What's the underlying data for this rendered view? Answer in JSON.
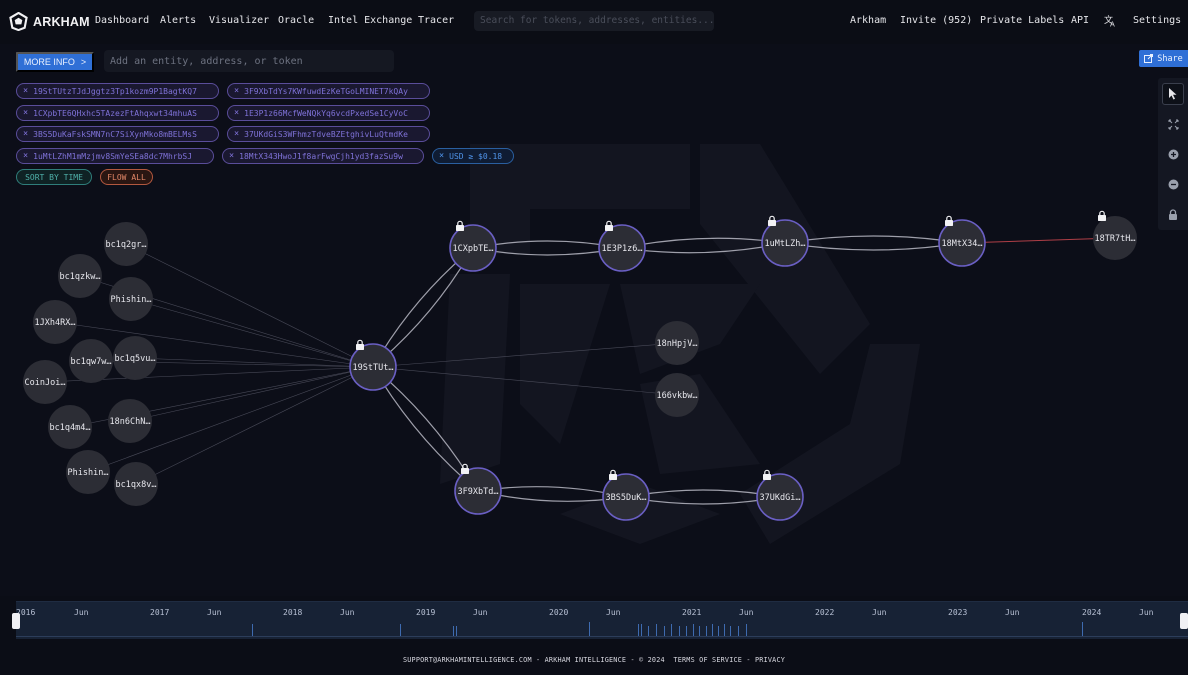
{
  "nav": {
    "brand": "ARKHAM",
    "items": [
      "Dashboard",
      "Alerts",
      "Visualizer",
      "Oracle",
      "Intel Exchange",
      "Tracer"
    ],
    "search_placeholder": "Search for tokens, addresses, entities...",
    "right_items": [
      "Arkham",
      "Invite (952)",
      "Private Labels",
      "API"
    ],
    "translate_icon": "translate-icon",
    "settings": "Settings"
  },
  "toolbar": {
    "more_info": "MORE INFO",
    "more_info_arrow": ">",
    "add_placeholder": "Add an entity, address, or token",
    "share": "Share"
  },
  "filters": {
    "addresses": [
      "19StTUtzTJdJggtz3Tp1kozm9P1BagtKQ7",
      "3F9XbTdYs7KWfuwdEzKeTGoLMINET7kQAy",
      "1CXpbTE6QHxhc5TAzezFtAhqxwt34mhuAS",
      "1E3P1z66McfWeNQkYq6vcdPxedSe1CyVoC",
      "3BS5DuKaFskSMN7nC7SiXynMko8mBELMsS",
      "37UKdGiS3WFhmzTdveBZEtghivLuQtmdKe",
      "1uMtLZhM1mMzjmv8SmYeSEa8dc7MhrbSJ",
      "18MtX343HwoJ1f8arFwgCjh1yd3fazSu9w"
    ],
    "usd_filter": "USD ≥ $0.18",
    "sort_by_time": "SORT BY TIME",
    "flow_all": "FLOW ALL",
    "remove_glyph": "×"
  },
  "graph": {
    "nodes": [
      {
        "id": "n1",
        "label": "bc1q2gr…",
        "tracked": false
      },
      {
        "id": "n2",
        "label": "bc1qzkw…",
        "tracked": false
      },
      {
        "id": "n3",
        "label": "Phishin…",
        "tracked": false
      },
      {
        "id": "n4",
        "label": "1JXh4RX…",
        "tracked": false
      },
      {
        "id": "n5",
        "label": "bc1qw7w…",
        "tracked": false
      },
      {
        "id": "n6",
        "label": "bc1q5vu…",
        "tracked": false
      },
      {
        "id": "n7",
        "label": "CoinJoi…",
        "tracked": false
      },
      {
        "id": "n8",
        "label": "bc1q4m4…",
        "tracked": false
      },
      {
        "id": "n9",
        "label": "18n6ChN…",
        "tracked": false
      },
      {
        "id": "n10",
        "label": "Phishin…",
        "tracked": false
      },
      {
        "id": "n11",
        "label": "bc1qx8v…",
        "tracked": false
      },
      {
        "id": "hub",
        "label": "19StTUt…",
        "tracked": true
      },
      {
        "id": "a1",
        "label": "1CXpbTE…",
        "tracked": true
      },
      {
        "id": "a2",
        "label": "1E3P1z6…",
        "tracked": true
      },
      {
        "id": "a3",
        "label": "1uMtLZh…",
        "tracked": true
      },
      {
        "id": "a4",
        "label": "18MtX34…",
        "tracked": true
      },
      {
        "id": "a5",
        "label": "18TR7tH…",
        "tracked": false,
        "locked": true
      },
      {
        "id": "b1",
        "label": "3F9XbTd…",
        "tracked": true
      },
      {
        "id": "b2",
        "label": "3BS5DuK…",
        "tracked": true
      },
      {
        "id": "b3",
        "label": "37UKdGi…",
        "tracked": true
      },
      {
        "id": "m1",
        "label": "18nHpjV…",
        "tracked": false
      },
      {
        "id": "m2",
        "label": "166vkbw…",
        "tracked": false
      }
    ],
    "edges": [
      {
        "from": "n1",
        "to": "hub",
        "type": "thin"
      },
      {
        "from": "n2",
        "to": "hub",
        "type": "thin"
      },
      {
        "from": "n3",
        "to": "hub",
        "type": "thin"
      },
      {
        "from": "n4",
        "to": "hub",
        "type": "thin"
      },
      {
        "from": "n5",
        "to": "hub",
        "type": "thin"
      },
      {
        "from": "n6",
        "to": "hub",
        "type": "thin"
      },
      {
        "from": "n7",
        "to": "hub",
        "type": "thin"
      },
      {
        "from": "n8",
        "to": "hub",
        "type": "thin"
      },
      {
        "from": "n9",
        "to": "hub",
        "type": "thin"
      },
      {
        "from": "n10",
        "to": "hub",
        "type": "thin"
      },
      {
        "from": "n11",
        "to": "hub",
        "type": "thin"
      },
      {
        "from": "hub",
        "to": "m1",
        "type": "thin"
      },
      {
        "from": "hub",
        "to": "m2",
        "type": "thin"
      },
      {
        "from": "hub",
        "to": "a1",
        "type": "double"
      },
      {
        "from": "hub",
        "to": "b1",
        "type": "double"
      },
      {
        "from": "a1",
        "to": "a2",
        "type": "double"
      },
      {
        "from": "a2",
        "to": "a3",
        "type": "double"
      },
      {
        "from": "a3",
        "to": "a4",
        "type": "double"
      },
      {
        "from": "a4",
        "to": "a5",
        "type": "red"
      },
      {
        "from": "b1",
        "to": "b2",
        "type": "double"
      },
      {
        "from": "b2",
        "to": "b3",
        "type": "double"
      }
    ]
  },
  "timeline": {
    "labels": [
      "2016",
      "Jun",
      "2017",
      "Jun",
      "2018",
      "Jun",
      "2019",
      "Jun",
      "2020",
      "Jun",
      "2021",
      "Jun",
      "2022",
      "Jun",
      "2023",
      "Jun",
      "2024",
      "Jun"
    ]
  },
  "footer": {
    "email": "SUPPORT@ARKHAMINTELLIGENCE.COM",
    "sep": " - ",
    "company": "ARKHAM INTELLIGENCE - © 2024",
    "terms": "TERMS OF SERVICE",
    "privacy": "PRIVACY"
  },
  "colors": {
    "accent": "#2f6fd6",
    "tracked_ring": "#6a5fc4",
    "node_fill": "#2c2d35",
    "red_edge": "#c0444c"
  }
}
